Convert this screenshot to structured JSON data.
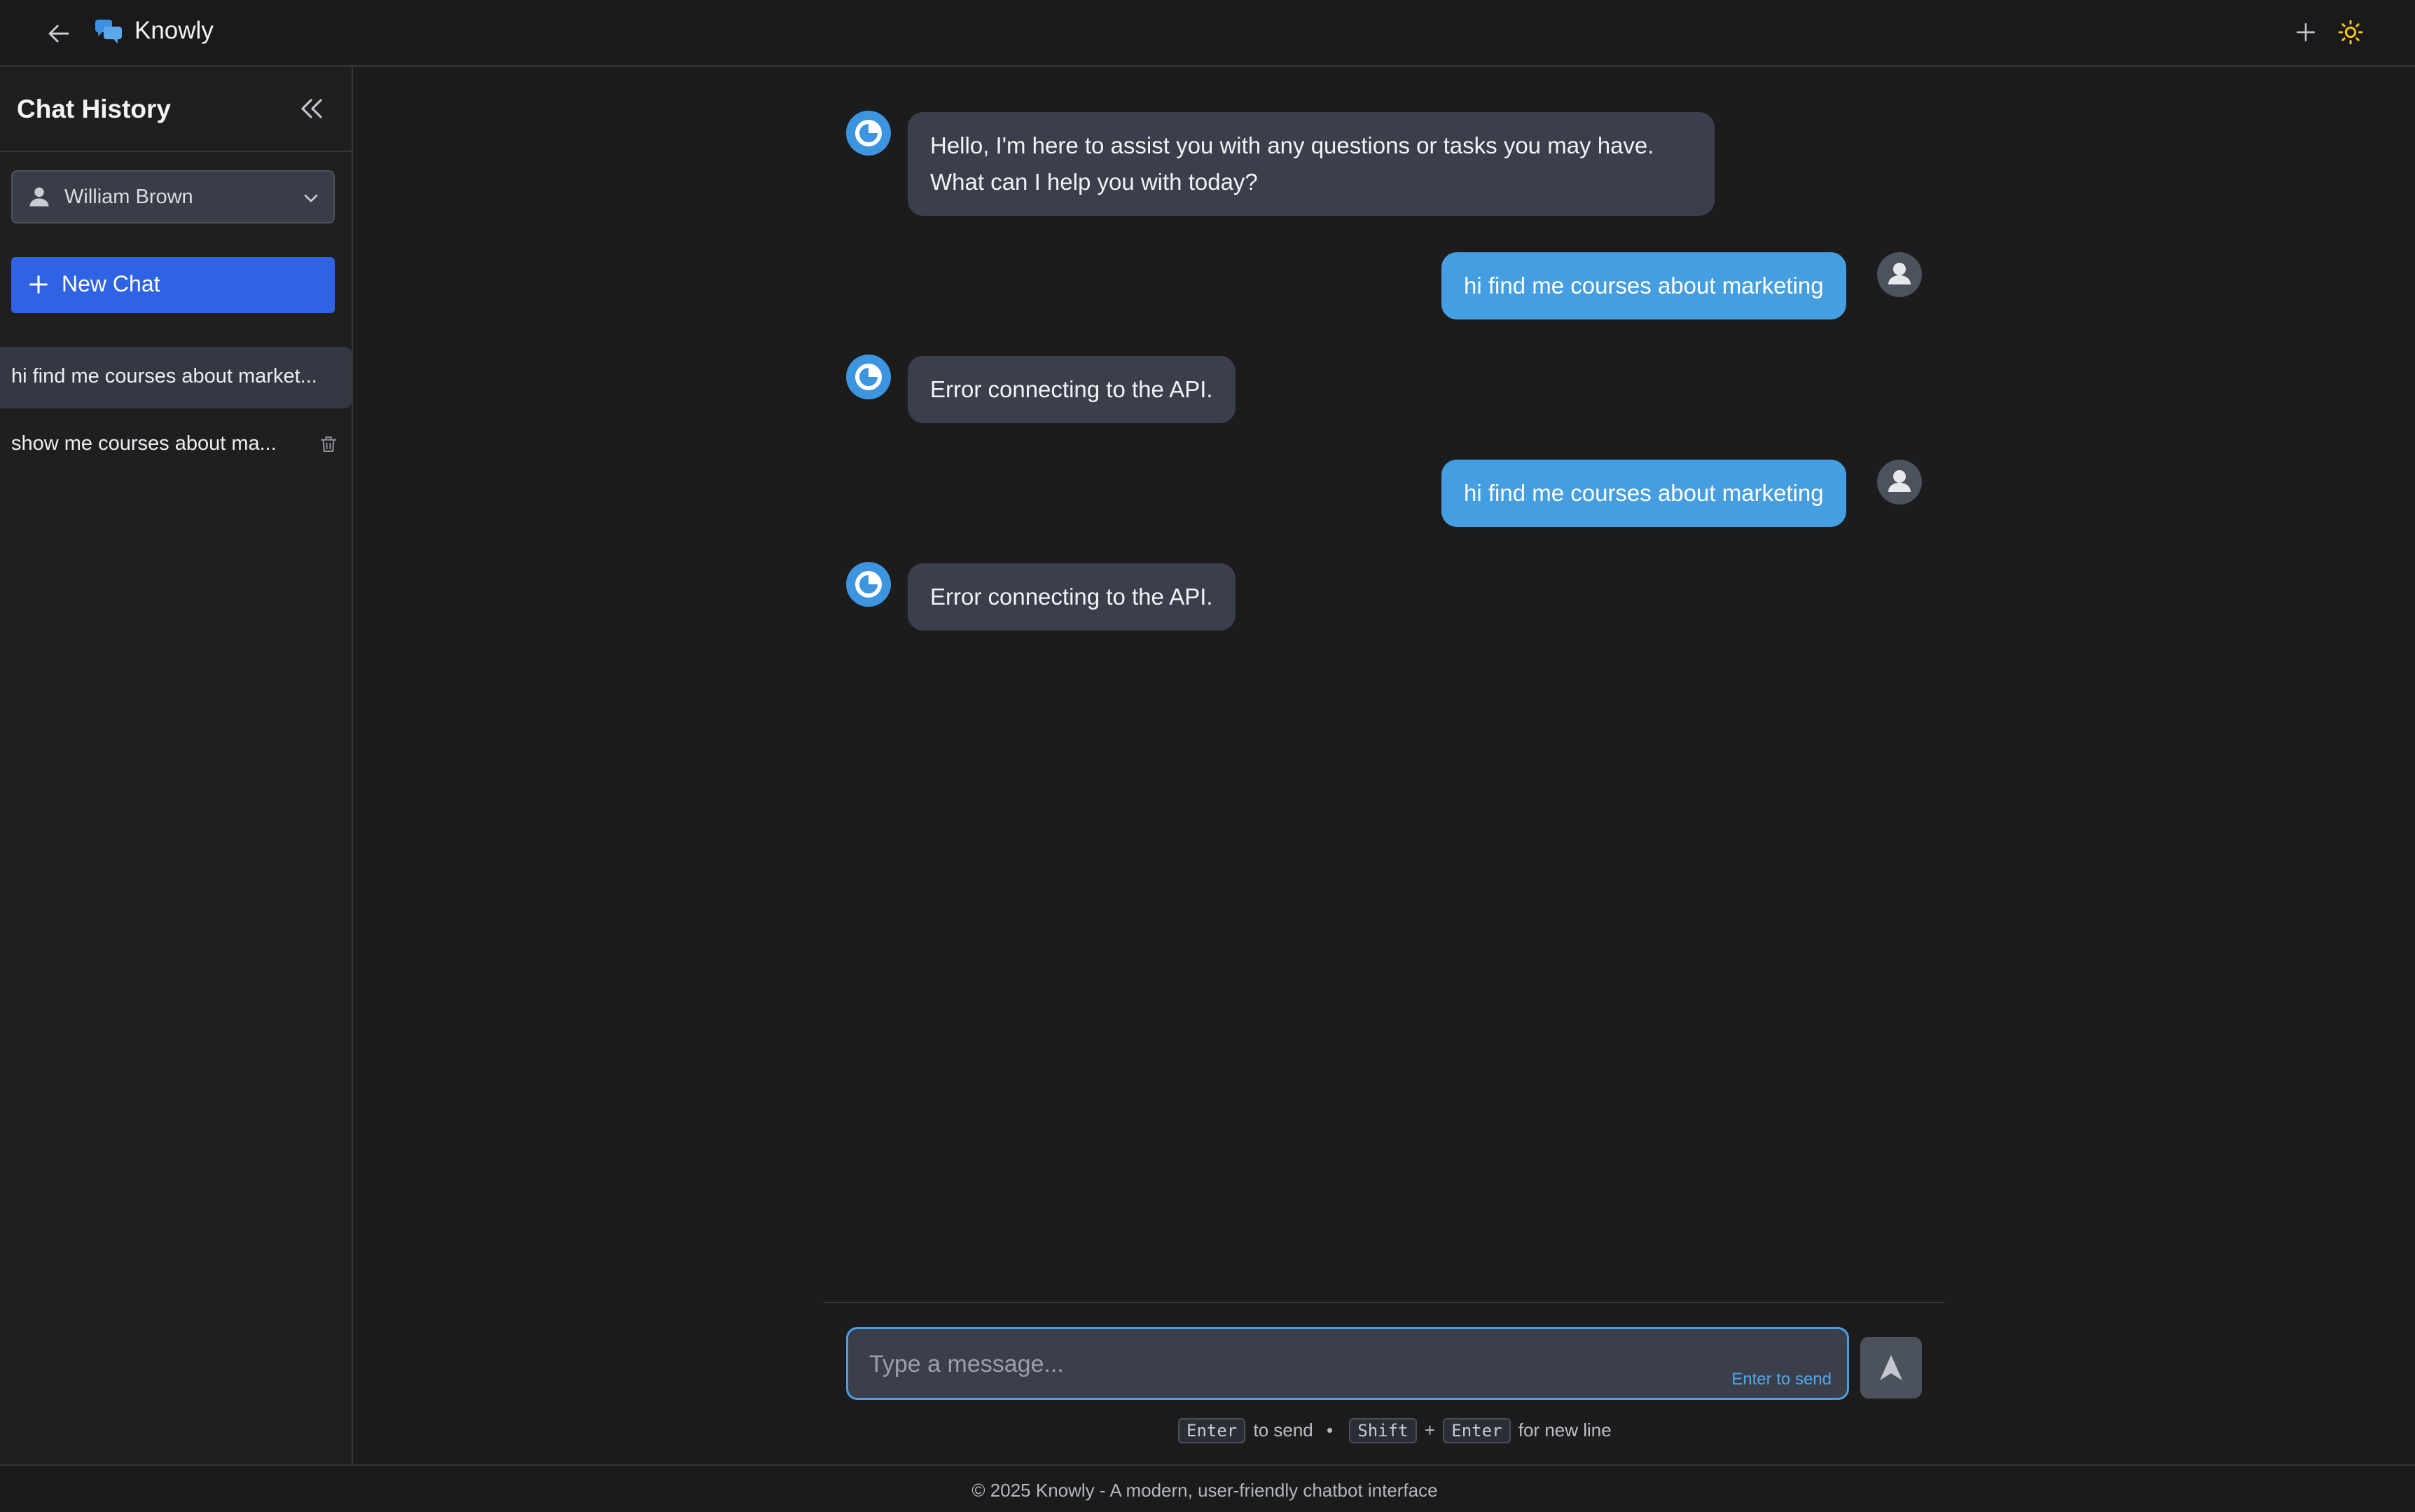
{
  "header": {
    "app_title": "Knowly",
    "back_icon": "arrow-left-icon",
    "logo_icon": "chat-bubbles-icon",
    "new_icon": "plus-icon",
    "theme_icon": "sun-icon"
  },
  "sidebar": {
    "title": "Chat History",
    "user": {
      "name": "William Brown"
    },
    "new_chat_label": "New Chat",
    "history": [
      {
        "label": "hi find me courses about market..."
      },
      {
        "label": "show me courses about ma..."
      }
    ]
  },
  "messages": [
    {
      "role": "assistant",
      "text": "Hello, I'm here to assist you with any questions or tasks you may have. What can I help you with today?"
    },
    {
      "role": "user",
      "text": "hi find me courses about marketing"
    },
    {
      "role": "assistant",
      "text": "Error connecting to the API."
    },
    {
      "role": "user",
      "text": "hi find me courses about marketing"
    },
    {
      "role": "assistant",
      "text": "Error connecting to the API."
    }
  ],
  "composer": {
    "placeholder": "Type a message...",
    "value": "",
    "enter_hint": "Enter to send"
  },
  "shortcuts": {
    "key_enter": "Enter",
    "send_text": "to send",
    "separator": "•",
    "key_shift": "Shift",
    "plus": "+",
    "key_enter2": "Enter",
    "newline_text": "for new line"
  },
  "footer": {
    "text": "© 2025 Knowly - A modern, user-friendly chatbot interface"
  },
  "colors": {
    "accent_blue": "#2f63e4",
    "user_bubble": "#459edf",
    "bot_bubble": "#3a3f4b",
    "theme_sun": "#f5c518"
  }
}
